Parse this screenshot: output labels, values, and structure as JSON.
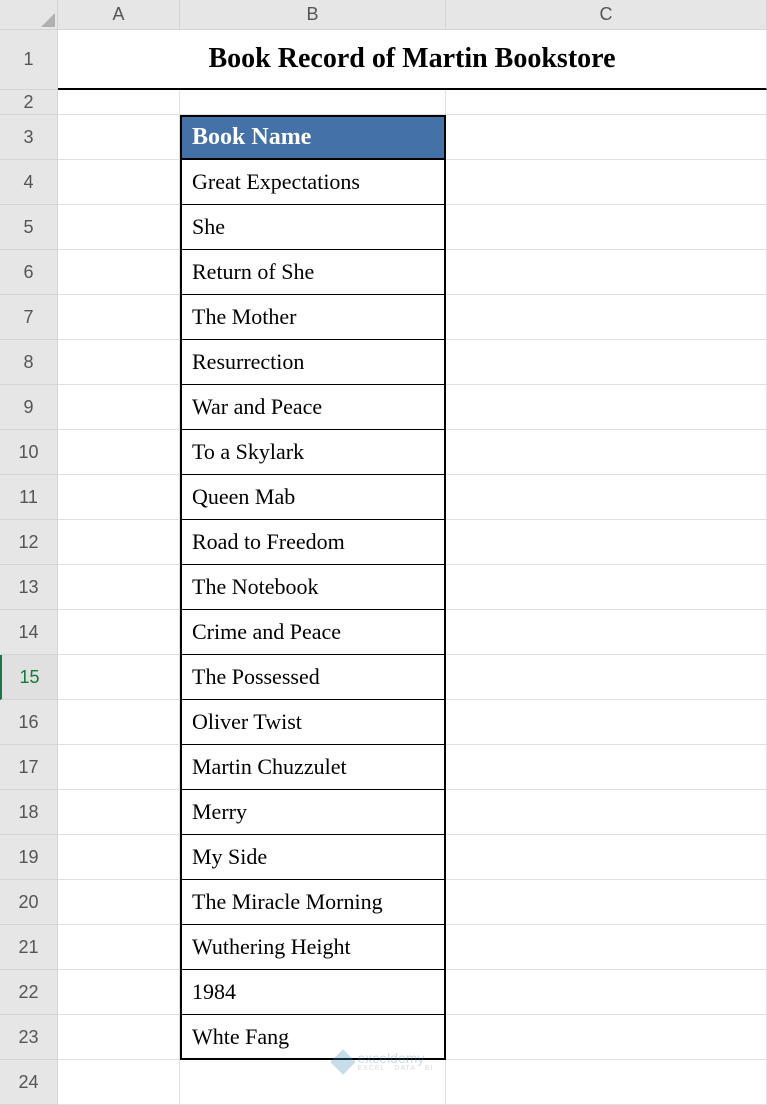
{
  "columns": [
    "A",
    "B",
    "C"
  ],
  "rows": [
    "1",
    "2",
    "3",
    "4",
    "5",
    "6",
    "7",
    "8",
    "9",
    "10",
    "11",
    "12",
    "13",
    "14",
    "15",
    "16",
    "17",
    "18",
    "19",
    "20",
    "21",
    "22",
    "23",
    "24"
  ],
  "selected_row": "15",
  "title": "Book Record of Martin Bookstore",
  "table": {
    "header": "Book Name",
    "items": [
      "Great Expectations",
      "She",
      "Return of She",
      "The Mother",
      "Resurrection",
      "War and Peace",
      "To a Skylark",
      "Queen Mab",
      "Road to Freedom",
      "The Notebook",
      "Crime and Peace",
      "The Possessed",
      "Oliver Twist",
      "Martin Chuzzulet",
      "Merry",
      "My Side",
      "The Miracle Morning",
      "Wuthering Height",
      "1984",
      "Whte Fang"
    ]
  },
  "watermark": {
    "brand": "exceldemy",
    "tagline": "EXCEL · DATA · BI"
  },
  "chart_data": {
    "type": "table",
    "title": "Book Record of Martin Bookstore",
    "columns": [
      "Book Name"
    ],
    "rows": [
      [
        "Great Expectations"
      ],
      [
        "She"
      ],
      [
        "Return of She"
      ],
      [
        "The Mother"
      ],
      [
        "Resurrection"
      ],
      [
        "War and Peace"
      ],
      [
        "To a Skylark"
      ],
      [
        "Queen Mab"
      ],
      [
        "Road to Freedom"
      ],
      [
        "The Notebook"
      ],
      [
        "Crime and Peace"
      ],
      [
        "The Possessed"
      ],
      [
        "Oliver Twist"
      ],
      [
        "Martin Chuzzulet"
      ],
      [
        "Merry"
      ],
      [
        "My Side"
      ],
      [
        "The Miracle Morning"
      ],
      [
        "Wuthering Height"
      ],
      [
        "1984"
      ],
      [
        "Whte Fang"
      ]
    ]
  }
}
